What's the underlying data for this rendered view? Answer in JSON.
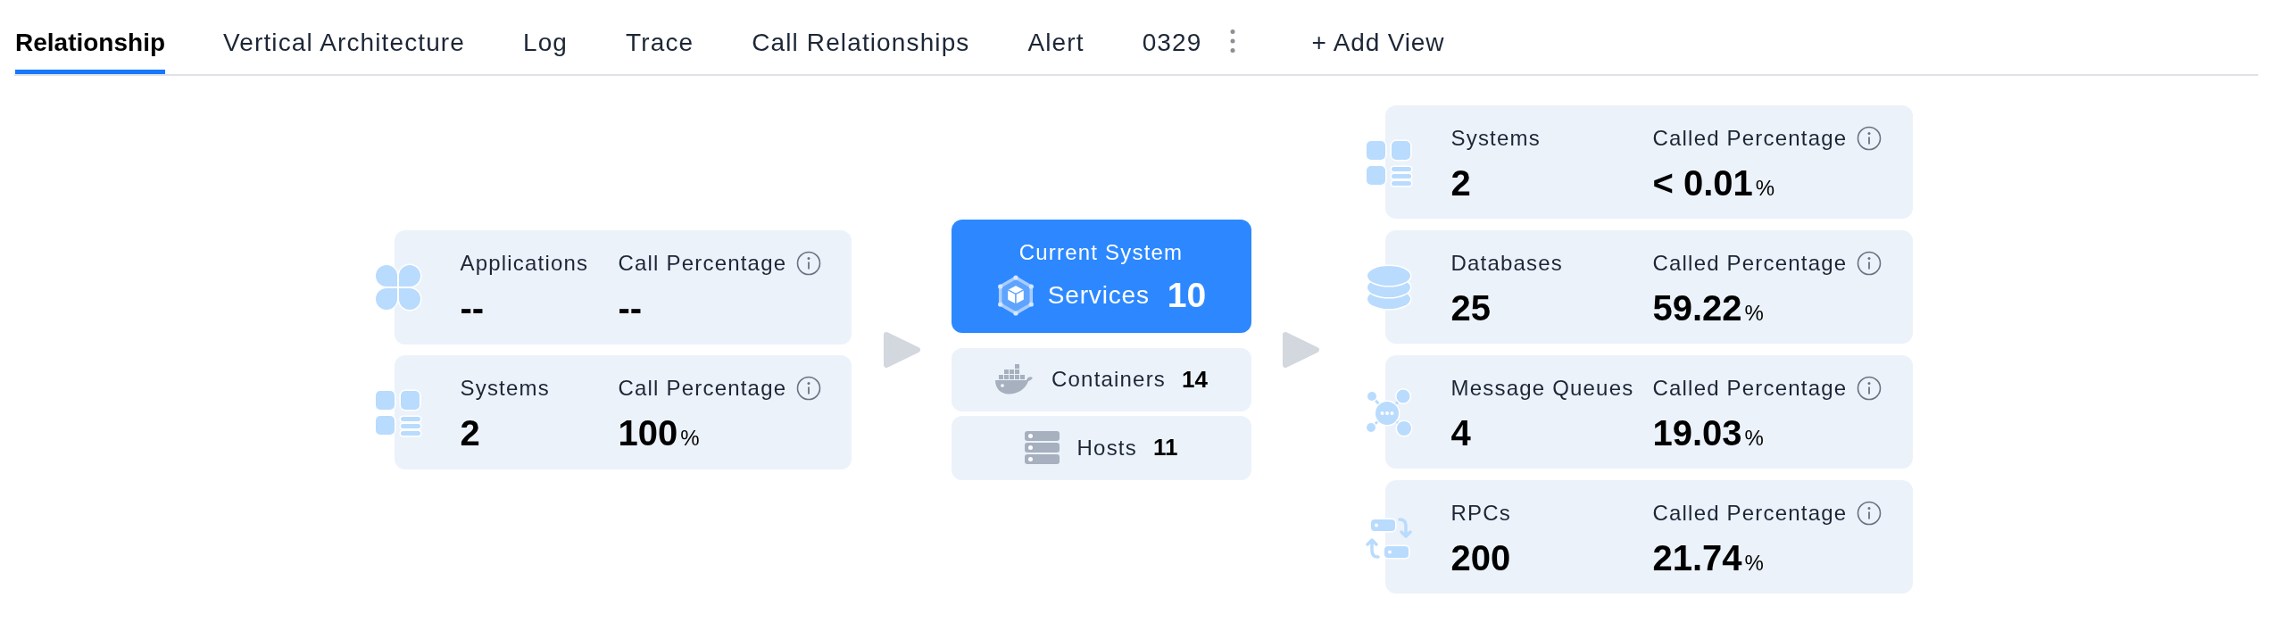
{
  "tabs": [
    {
      "label": "Relationship",
      "selected": true
    },
    {
      "label": "Vertical Architecture",
      "selected": false
    },
    {
      "label": "Log",
      "selected": false
    },
    {
      "label": "Trace",
      "selected": false
    },
    {
      "label": "Call Relationships",
      "selected": false
    },
    {
      "label": "Alert",
      "selected": false
    },
    {
      "label": "0329",
      "selected": false
    }
  ],
  "add_view": {
    "label": "+ Add View"
  },
  "callers": [
    {
      "kind": "applications",
      "label": "Applications",
      "count": "--",
      "percentage_label": "Call Percentage",
      "percentage": "--"
    },
    {
      "kind": "systems",
      "label": "Systems",
      "count": "2",
      "percentage_label": "Call Percentage",
      "percentage": "100",
      "unit": "%"
    }
  ],
  "current_system": {
    "title": "Current System",
    "label": "Services",
    "count": "10"
  },
  "resources": [
    {
      "kind": "containers",
      "label": "Containers",
      "count": "14"
    },
    {
      "kind": "hosts",
      "label": "Hosts",
      "count": "11"
    }
  ],
  "callees": [
    {
      "kind": "systems",
      "label": "Systems",
      "count": "2",
      "percentage_label": "Called Percentage",
      "percentage": "< 0.01",
      "unit": "%"
    },
    {
      "kind": "databases",
      "label": "Databases",
      "count": "25",
      "percentage_label": "Called Percentage",
      "percentage": "59.22",
      "unit": "%"
    },
    {
      "kind": "message_queues",
      "label": "Message Queues",
      "count": "4",
      "percentage_label": "Called Percentage",
      "percentage": "19.03",
      "unit": "%"
    },
    {
      "kind": "rpcs",
      "label": "RPCs",
      "count": "200",
      "percentage_label": "Called Percentage",
      "percentage": "21.74",
      "unit": "%"
    }
  ]
}
